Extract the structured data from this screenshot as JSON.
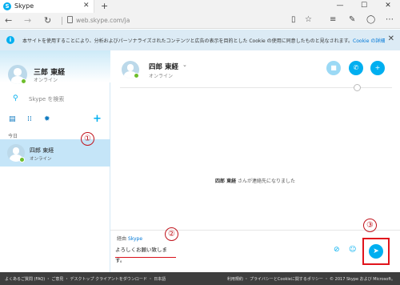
{
  "browser": {
    "tab_icon": "S",
    "tab_title": "Skype",
    "tab_close": "✕",
    "new_tab": "+",
    "url_host": "web.skype.com",
    "url_path": "/ja",
    "window_controls": [
      "—",
      "☐",
      "✕"
    ]
  },
  "cookie_banner": {
    "text": "本サイトを使用することにより、分析およびパーソナライズされたコンテンツと広告の表示を目的とした Cookie の使用に同意したものと見なされます。",
    "link": "Cookie の詳細",
    "close": "✕"
  },
  "sidebar": {
    "user_name": "三郎 東経",
    "user_status": "オンライン",
    "search_label": "Skype を検索",
    "section_today": "今日",
    "contact": {
      "name": "四郎 東経",
      "status": "オンライン"
    }
  },
  "chat": {
    "contact_name": "四郎 東経",
    "contact_status": "オンライン",
    "system_name": "四郎 東経",
    "system_text": "さんが連絡先になりました",
    "via_label": "経由",
    "via_service": "Skype",
    "message_draft": "よろしくお願い致します。"
  },
  "annotations": [
    "①",
    "②",
    "③"
  ],
  "footer": {
    "left": "よくあるご質問 (FAQ) ・ ご意見 ・ デスクトップ クライアントをダウンロード ・ 日本語",
    "right": "利用規約 ・ プライバシーとCookieに関するポリシー ・ © 2017 Skype および Microsoft。"
  },
  "colors": {
    "skype_blue": "#00aff0",
    "presence_green": "#6dbe2c",
    "annotation_red": "#e1141c",
    "selected_row": "#c5e5f8"
  },
  "icons": [
    "skype-icon",
    "back-icon",
    "forward-icon",
    "refresh-icon",
    "lock-icon",
    "reading-view-icon",
    "favorite-icon",
    "hub-icon",
    "notes-icon",
    "share-icon",
    "more-icon",
    "info-icon",
    "search-icon",
    "contacts-icon",
    "dialpad-icon",
    "settings-icon",
    "plus-icon",
    "chevron-down-icon",
    "video-call-icon",
    "audio-call-icon",
    "add-person-icon",
    "globe-icon",
    "attachment-icon",
    "emoticon-icon",
    "send-icon"
  ]
}
